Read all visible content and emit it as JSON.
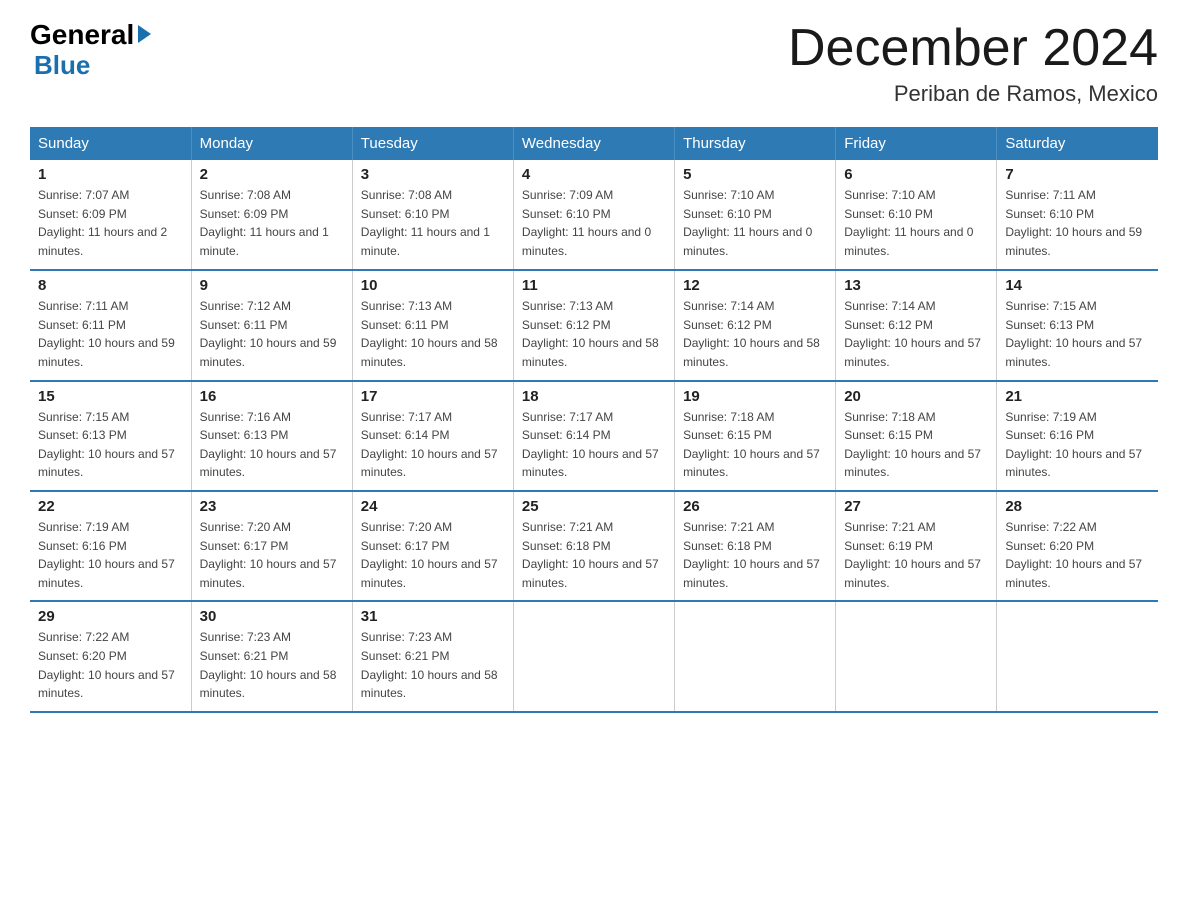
{
  "logo": {
    "general": "General",
    "arrow": "▶",
    "blue": "Blue"
  },
  "header": {
    "month_title": "December 2024",
    "location": "Periban de Ramos, Mexico"
  },
  "days_of_week": [
    "Sunday",
    "Monday",
    "Tuesday",
    "Wednesday",
    "Thursday",
    "Friday",
    "Saturday"
  ],
  "weeks": [
    [
      {
        "num": "1",
        "sunrise": "7:07 AM",
        "sunset": "6:09 PM",
        "daylight": "11 hours and 2 minutes."
      },
      {
        "num": "2",
        "sunrise": "7:08 AM",
        "sunset": "6:09 PM",
        "daylight": "11 hours and 1 minute."
      },
      {
        "num": "3",
        "sunrise": "7:08 AM",
        "sunset": "6:10 PM",
        "daylight": "11 hours and 1 minute."
      },
      {
        "num": "4",
        "sunrise": "7:09 AM",
        "sunset": "6:10 PM",
        "daylight": "11 hours and 0 minutes."
      },
      {
        "num": "5",
        "sunrise": "7:10 AM",
        "sunset": "6:10 PM",
        "daylight": "11 hours and 0 minutes."
      },
      {
        "num": "6",
        "sunrise": "7:10 AM",
        "sunset": "6:10 PM",
        "daylight": "11 hours and 0 minutes."
      },
      {
        "num": "7",
        "sunrise": "7:11 AM",
        "sunset": "6:10 PM",
        "daylight": "10 hours and 59 minutes."
      }
    ],
    [
      {
        "num": "8",
        "sunrise": "7:11 AM",
        "sunset": "6:11 PM",
        "daylight": "10 hours and 59 minutes."
      },
      {
        "num": "9",
        "sunrise": "7:12 AM",
        "sunset": "6:11 PM",
        "daylight": "10 hours and 59 minutes."
      },
      {
        "num": "10",
        "sunrise": "7:13 AM",
        "sunset": "6:11 PM",
        "daylight": "10 hours and 58 minutes."
      },
      {
        "num": "11",
        "sunrise": "7:13 AM",
        "sunset": "6:12 PM",
        "daylight": "10 hours and 58 minutes."
      },
      {
        "num": "12",
        "sunrise": "7:14 AM",
        "sunset": "6:12 PM",
        "daylight": "10 hours and 58 minutes."
      },
      {
        "num": "13",
        "sunrise": "7:14 AM",
        "sunset": "6:12 PM",
        "daylight": "10 hours and 57 minutes."
      },
      {
        "num": "14",
        "sunrise": "7:15 AM",
        "sunset": "6:13 PM",
        "daylight": "10 hours and 57 minutes."
      }
    ],
    [
      {
        "num": "15",
        "sunrise": "7:15 AM",
        "sunset": "6:13 PM",
        "daylight": "10 hours and 57 minutes."
      },
      {
        "num": "16",
        "sunrise": "7:16 AM",
        "sunset": "6:13 PM",
        "daylight": "10 hours and 57 minutes."
      },
      {
        "num": "17",
        "sunrise": "7:17 AM",
        "sunset": "6:14 PM",
        "daylight": "10 hours and 57 minutes."
      },
      {
        "num": "18",
        "sunrise": "7:17 AM",
        "sunset": "6:14 PM",
        "daylight": "10 hours and 57 minutes."
      },
      {
        "num": "19",
        "sunrise": "7:18 AM",
        "sunset": "6:15 PM",
        "daylight": "10 hours and 57 minutes."
      },
      {
        "num": "20",
        "sunrise": "7:18 AM",
        "sunset": "6:15 PM",
        "daylight": "10 hours and 57 minutes."
      },
      {
        "num": "21",
        "sunrise": "7:19 AM",
        "sunset": "6:16 PM",
        "daylight": "10 hours and 57 minutes."
      }
    ],
    [
      {
        "num": "22",
        "sunrise": "7:19 AM",
        "sunset": "6:16 PM",
        "daylight": "10 hours and 57 minutes."
      },
      {
        "num": "23",
        "sunrise": "7:20 AM",
        "sunset": "6:17 PM",
        "daylight": "10 hours and 57 minutes."
      },
      {
        "num": "24",
        "sunrise": "7:20 AM",
        "sunset": "6:17 PM",
        "daylight": "10 hours and 57 minutes."
      },
      {
        "num": "25",
        "sunrise": "7:21 AM",
        "sunset": "6:18 PM",
        "daylight": "10 hours and 57 minutes."
      },
      {
        "num": "26",
        "sunrise": "7:21 AM",
        "sunset": "6:18 PM",
        "daylight": "10 hours and 57 minutes."
      },
      {
        "num": "27",
        "sunrise": "7:21 AM",
        "sunset": "6:19 PM",
        "daylight": "10 hours and 57 minutes."
      },
      {
        "num": "28",
        "sunrise": "7:22 AM",
        "sunset": "6:20 PM",
        "daylight": "10 hours and 57 minutes."
      }
    ],
    [
      {
        "num": "29",
        "sunrise": "7:22 AM",
        "sunset": "6:20 PM",
        "daylight": "10 hours and 57 minutes."
      },
      {
        "num": "30",
        "sunrise": "7:23 AM",
        "sunset": "6:21 PM",
        "daylight": "10 hours and 58 minutes."
      },
      {
        "num": "31",
        "sunrise": "7:23 AM",
        "sunset": "6:21 PM",
        "daylight": "10 hours and 58 minutes."
      },
      null,
      null,
      null,
      null
    ]
  ]
}
